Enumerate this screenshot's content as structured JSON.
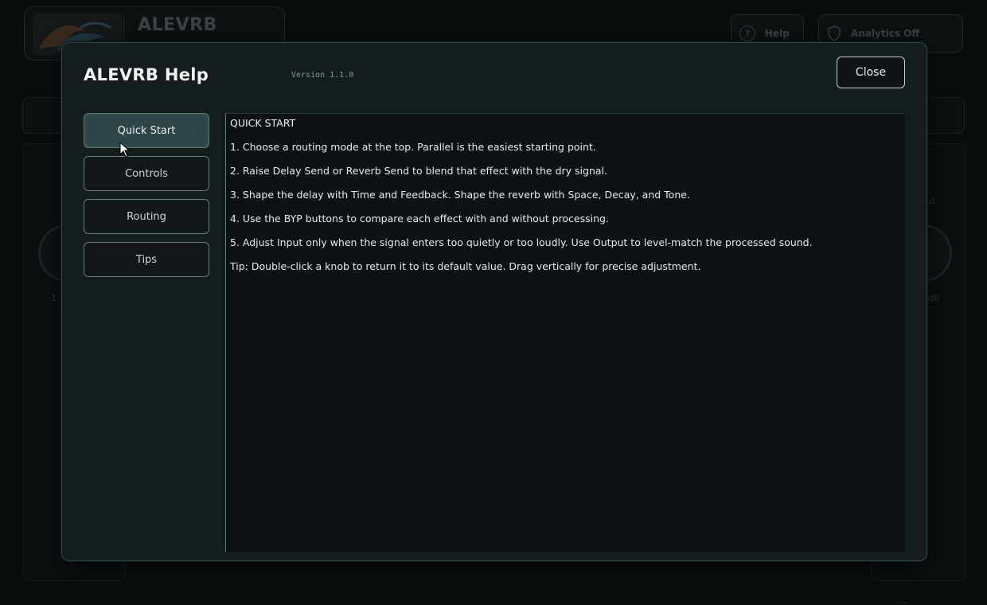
{
  "background": {
    "app_title": "ALEVRB",
    "help_label": "Help",
    "help_icon_glyph": "?",
    "analytics_label": "Analytics Off",
    "left_readout": "-1",
    "right_readout": "dB",
    "right_out_label": "ut",
    "footer_text": "...",
    "colors": {
      "accent": "#2a4a48"
    }
  },
  "dialog": {
    "title": "ALEVRB Help",
    "version": "Version 1.1.0",
    "close_label": "Close",
    "nav": [
      {
        "label": "Quick Start",
        "active": true
      },
      {
        "label": "Controls",
        "active": false
      },
      {
        "label": "Routing",
        "active": false
      },
      {
        "label": "Tips",
        "active": false
      }
    ],
    "content": {
      "heading": "QUICK START",
      "lines": [
        "1. Choose a routing mode at the top. Parallel is the easiest starting point.",
        "2. Raise Delay Send or Reverb Send to blend that effect with the dry signal.",
        "3. Shape the delay with Time and Feedback. Shape the reverb with Space, Decay, and Tone.",
        "4. Use the BYP buttons to compare each effect with and without processing.",
        "5. Adjust Input only when the signal enters too quietly or too loudly. Use Output to level-match the processed sound.",
        "Tip: Double-click a knob to return it to its default value. Drag vertically for precise adjustment."
      ]
    }
  },
  "icons": {
    "help": "question-circle-icon",
    "analytics": "shield-icon",
    "logo": "wave-logo",
    "cursor": "mouse-cursor"
  }
}
